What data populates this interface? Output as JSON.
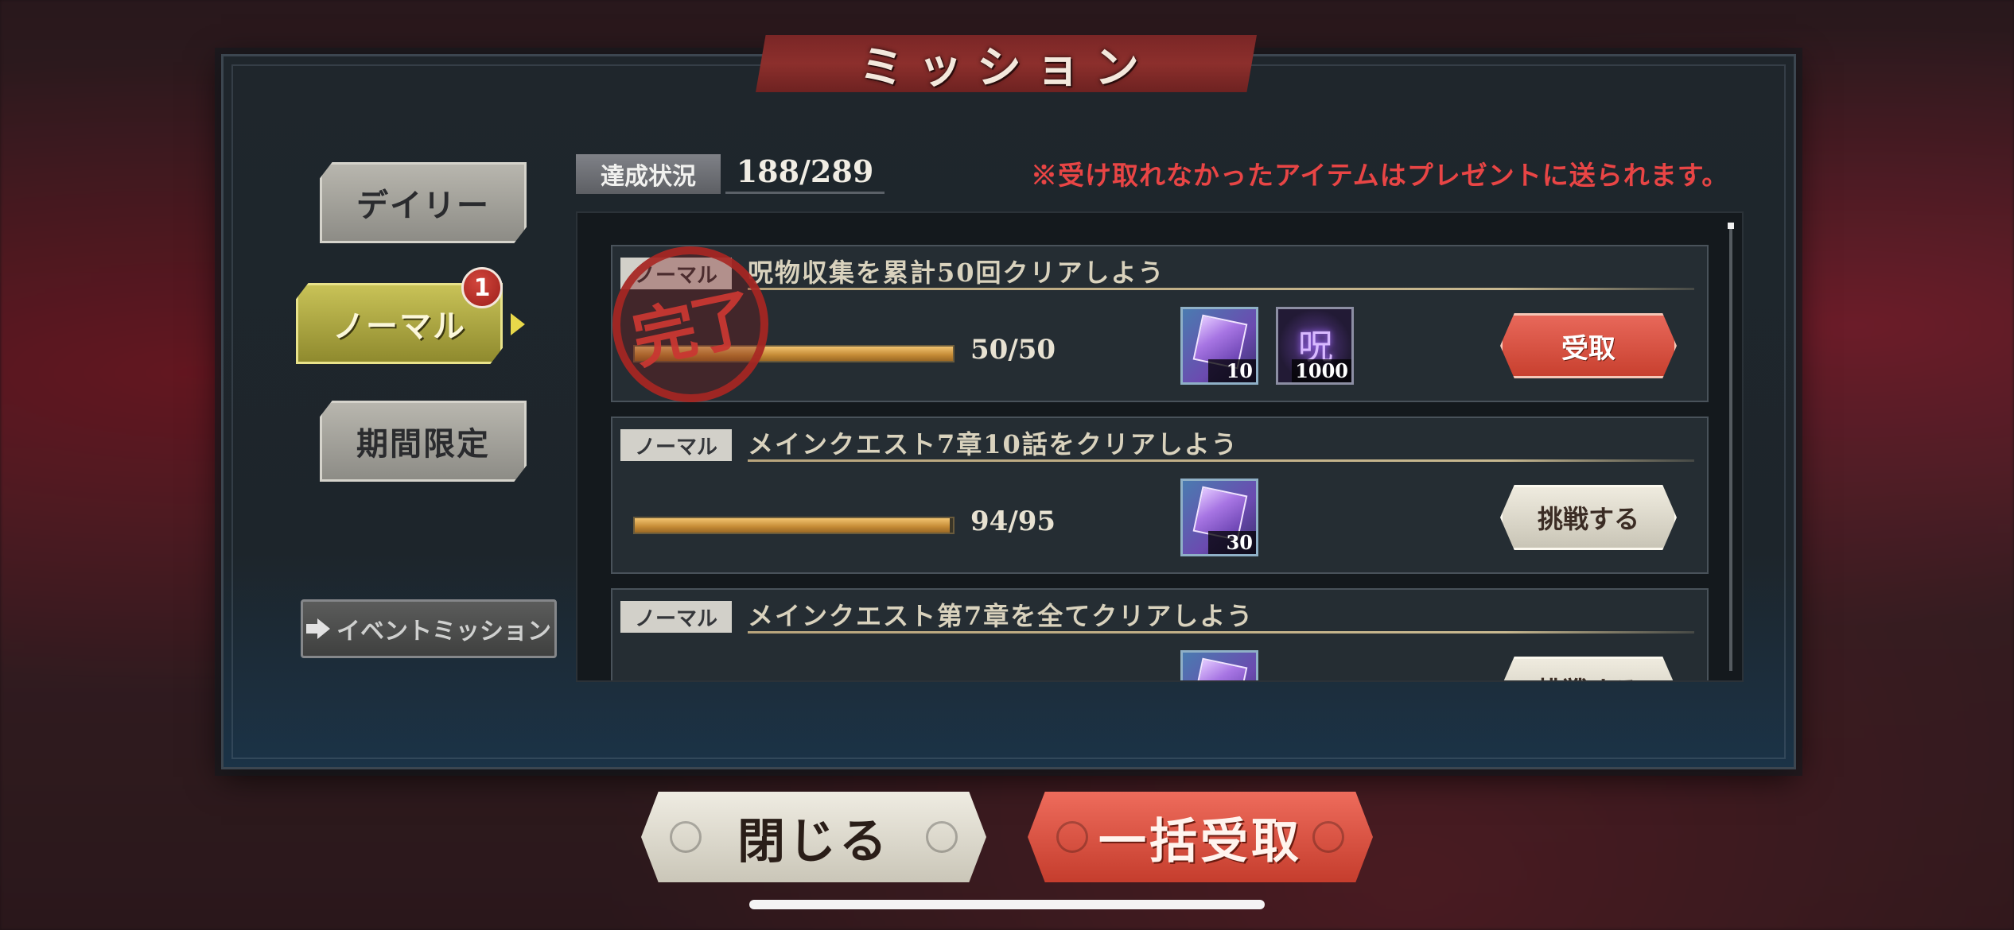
{
  "title": "ミッション",
  "tabs": [
    {
      "label": "デイリー",
      "selected": false
    },
    {
      "label": "ノーマル",
      "selected": true,
      "badge": "1"
    },
    {
      "label": "期間限定",
      "selected": false
    }
  ],
  "event_mission_label": "イベントミッション",
  "progress": {
    "label": "達成状況",
    "value": "188/289"
  },
  "notice": "※受け取れなかったアイテムはプレゼントに送られます。",
  "missions": [
    {
      "type": "ノーマル",
      "name": "呪物収集を累計50回クリアしよう",
      "count": "50/50",
      "progress": 1.0,
      "completed": true,
      "stamp": "完了",
      "rewards": [
        {
          "icon": "purple-cube-icon",
          "qty": "10"
        },
        {
          "icon": "curse-energy-icon",
          "qty": "1000",
          "glyph": "呪"
        }
      ],
      "button": "受取"
    },
    {
      "type": "ノーマル",
      "name": "メインクエスト7章10話をクリアしよう",
      "count": "94/95",
      "progress": 0.9895,
      "completed": false,
      "rewards": [
        {
          "icon": "purple-cube-icon",
          "qty": "30"
        }
      ],
      "button": "挑戦する"
    },
    {
      "type": "ノーマル",
      "name": "メインクエスト第7章を全てクリアしよう",
      "rewards": [
        {
          "icon": "purple-cube-icon"
        }
      ],
      "button": "挑戦する"
    }
  ],
  "bottom": {
    "close": "閉じる",
    "claim_all": "一括受取"
  }
}
